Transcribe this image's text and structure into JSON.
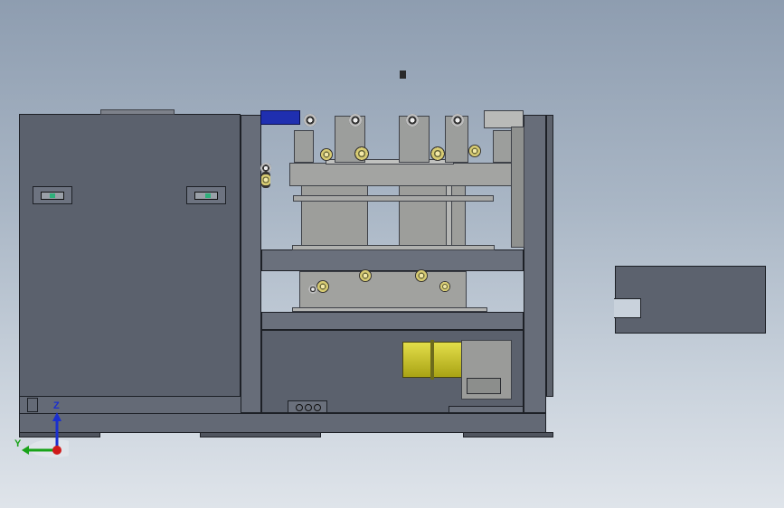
{
  "viewport": {
    "background_top": "#8e9db0",
    "background_bottom": "#dfe4ea"
  },
  "model": {
    "panel_color": "#5b616d",
    "metal_color": "#9c9e9c",
    "highlight_color": "#1f2fb0",
    "motor_color": "#c9c41a",
    "gear_color": "#d8cc73"
  },
  "triad": {
    "z_label": "Z",
    "y_label": "Y",
    "z_color": "#1a2fd0",
    "y_color": "#19a319",
    "x_color": "#d01a1a"
  }
}
